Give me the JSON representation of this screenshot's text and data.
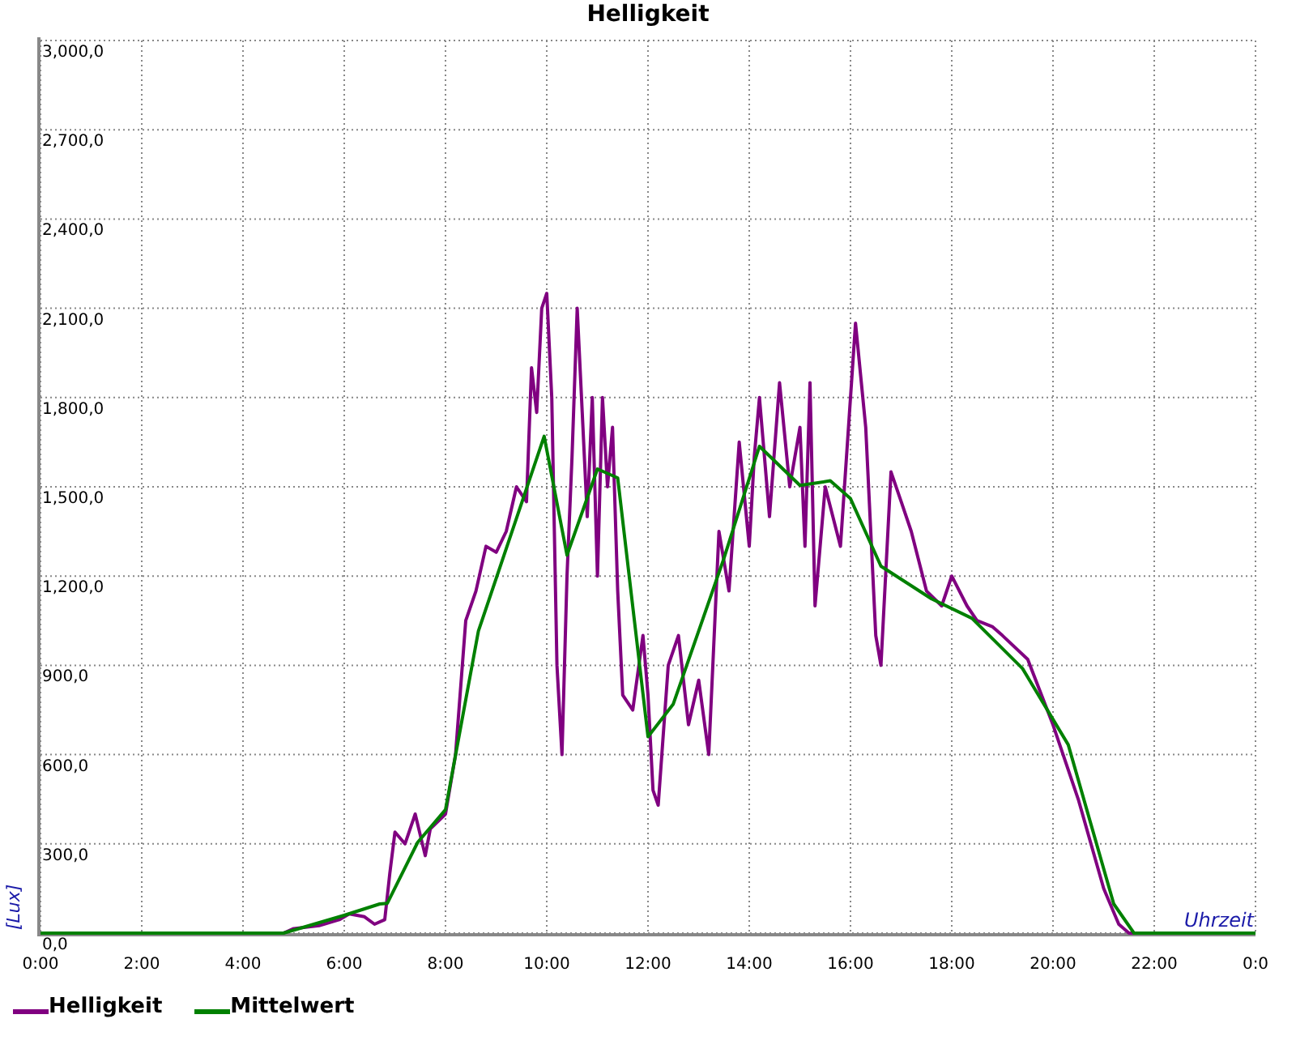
{
  "chart_data": {
    "type": "line",
    "grid": true,
    "title": "Helligkeit",
    "xlabel": "Uhrzeit",
    "ylabel": "[Lux]",
    "xlim": [
      0,
      24
    ],
    "ylim": [
      0,
      3000
    ],
    "xticks": [
      {
        "value": 0,
        "label": "0:00"
      },
      {
        "value": 2,
        "label": "2:00"
      },
      {
        "value": 4,
        "label": "4:00"
      },
      {
        "value": 6,
        "label": "6:00"
      },
      {
        "value": 8,
        "label": "8:00"
      },
      {
        "value": 10,
        "label": "10:00"
      },
      {
        "value": 12,
        "label": "12:00"
      },
      {
        "value": 14,
        "label": "14:00"
      },
      {
        "value": 16,
        "label": "16:00"
      },
      {
        "value": 18,
        "label": "18:00"
      },
      {
        "value": 20,
        "label": "20:00"
      },
      {
        "value": 22,
        "label": "22:00"
      },
      {
        "value": 24,
        "label": "0:0"
      }
    ],
    "yticks": [
      {
        "value": 0,
        "label": "0,0"
      },
      {
        "value": 300,
        "label": "300,0"
      },
      {
        "value": 600,
        "label": "600,0"
      },
      {
        "value": 900,
        "label": "900,0"
      },
      {
        "value": 1200,
        "label": "1,200,0"
      },
      {
        "value": 1500,
        "label": "1,500,0"
      },
      {
        "value": 1800,
        "label": "1,800,0"
      },
      {
        "value": 2100,
        "label": "2,100,0"
      },
      {
        "value": 2400,
        "label": "2,400,0"
      },
      {
        "value": 2700,
        "label": "2,700,0"
      },
      {
        "value": 3000,
        "label": "3,000,0"
      }
    ],
    "series": [
      {
        "name": "Helligkeit",
        "color": "#800080",
        "x": [
          0,
          4.8,
          5.0,
          5.5,
          5.9,
          6.1,
          6.4,
          6.6,
          6.8,
          6.9,
          7.0,
          7.2,
          7.4,
          7.6,
          7.7,
          8.0,
          8.2,
          8.4,
          8.6,
          8.8,
          9.0,
          9.2,
          9.4,
          9.6,
          9.7,
          9.8,
          9.9,
          10.0,
          10.1,
          10.2,
          10.3,
          10.4,
          10.5,
          10.6,
          10.7,
          10.8,
          10.9,
          11.0,
          11.1,
          11.2,
          11.3,
          11.4,
          11.5,
          11.7,
          11.9,
          12.0,
          12.1,
          12.2,
          12.4,
          12.6,
          12.8,
          13.0,
          13.2,
          13.4,
          13.6,
          13.8,
          14.0,
          14.1,
          14.2,
          14.4,
          14.6,
          14.8,
          15.0,
          15.1,
          15.2,
          15.3,
          15.5,
          15.8,
          16.0,
          16.1,
          16.3,
          16.5,
          16.6,
          16.8,
          17.0,
          17.2,
          17.5,
          17.8,
          18.0,
          18.3,
          18.5,
          18.8,
          19.0,
          19.5,
          20.0,
          20.5,
          21.0,
          21.3,
          21.5,
          24
        ],
        "values": [
          0,
          0,
          15,
          25,
          45,
          65,
          55,
          30,
          45,
          200,
          340,
          300,
          400,
          260,
          350,
          400,
          600,
          1050,
          1150,
          1300,
          1280,
          1350,
          1500,
          1450,
          1900,
          1750,
          2100,
          2150,
          1800,
          900,
          600,
          1200,
          1600,
          2100,
          1750,
          1400,
          1800,
          1200,
          1800,
          1500,
          1700,
          1150,
          800,
          750,
          1000,
          800,
          480,
          430,
          900,
          1000,
          700,
          850,
          600,
          1350,
          1150,
          1650,
          1300,
          1600,
          1800,
          1400,
          1850,
          1500,
          1700,
          1300,
          1850,
          1100,
          1500,
          1300,
          1800,
          2050,
          1700,
          1000,
          900,
          1550,
          1450,
          1350,
          1150,
          1100,
          1200,
          1100,
          1050,
          1030,
          1000,
          920,
          700,
          450,
          150,
          30,
          0,
          0
        ]
      },
      {
        "name": "Mittelwert",
        "color": "#008000",
        "x": [
          0,
          4.8,
          6.0,
          6.7,
          6.85,
          7.45,
          8.0,
          8.65,
          9.95,
          10.4,
          11.0,
          11.4,
          12.0,
          12.5,
          13.5,
          14.2,
          15.0,
          15.6,
          16.0,
          16.6,
          17.6,
          18.4,
          19.4,
          20.3,
          21.2,
          21.6,
          24
        ],
        "values": [
          0,
          0,
          60,
          98,
          100,
          305,
          415,
          1015,
          1670,
          1270,
          1560,
          1530,
          660,
          770,
          1260,
          1636,
          1505,
          1520,
          1460,
          1233,
          1124,
          1058,
          889,
          633,
          98,
          0,
          0
        ]
      }
    ]
  }
}
